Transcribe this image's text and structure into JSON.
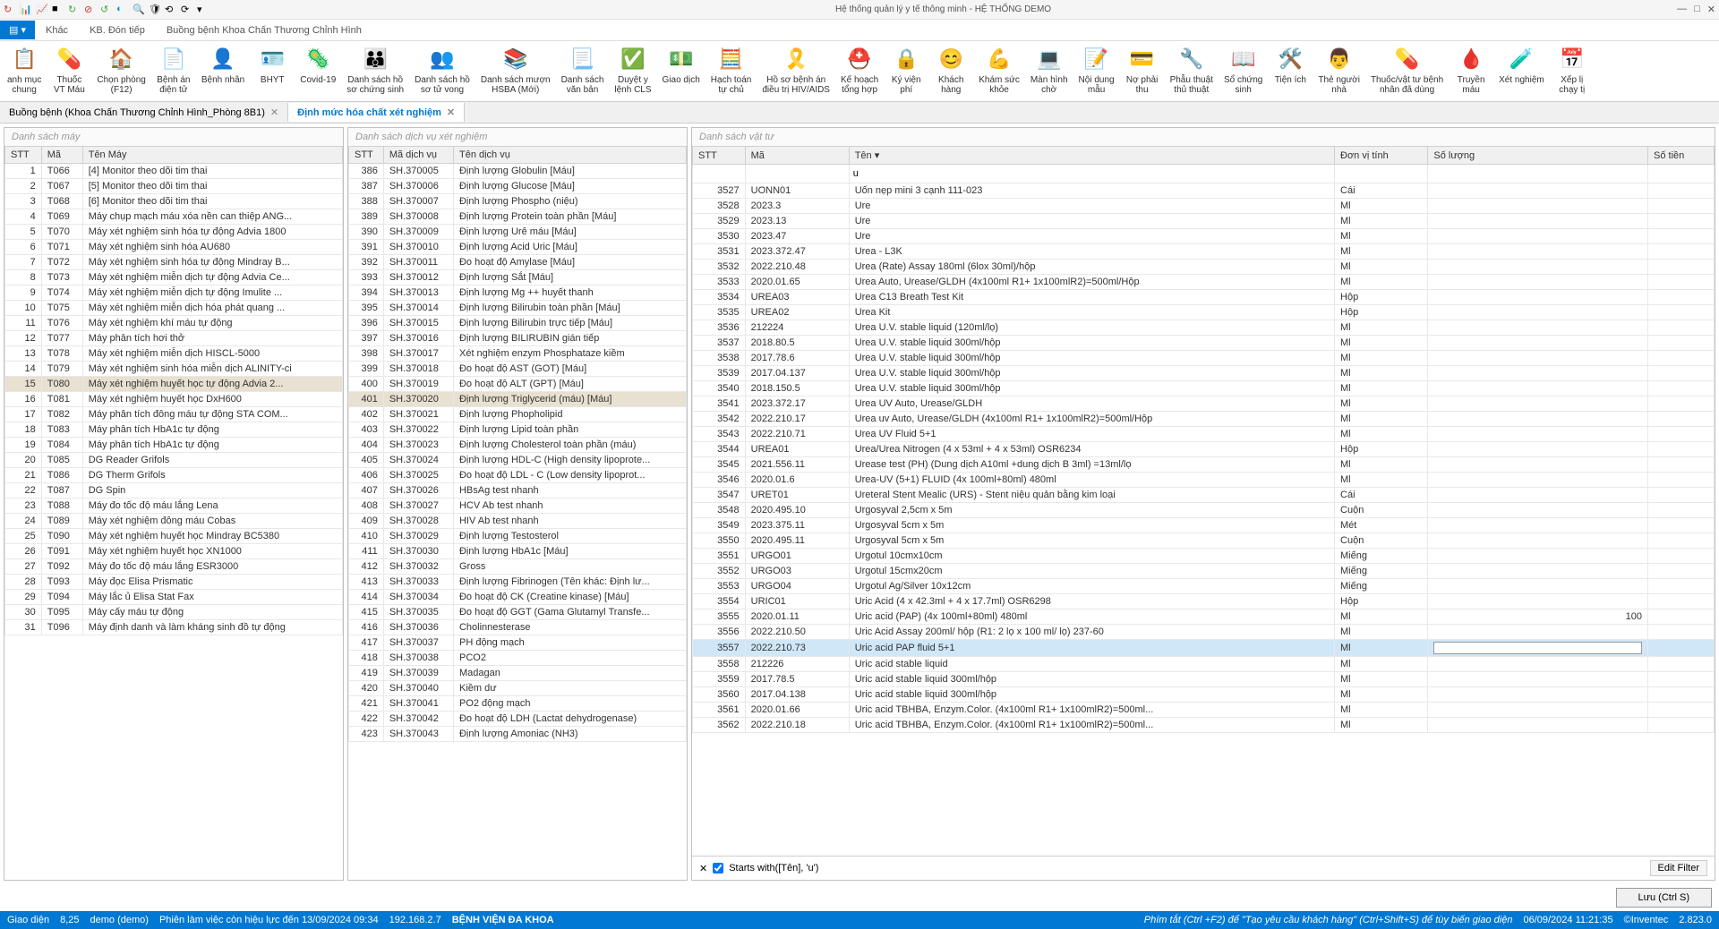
{
  "titlebar": {
    "title": "Hệ thống quản lý y tế thông minh - HỆ THỐNG DEMO"
  },
  "ribbonTabs": [
    {
      "label": "Khác",
      "active": false
    },
    {
      "label": "KB. Đón tiếp",
      "active": false
    },
    {
      "label": "Buồng bệnh Khoa Chấn Thương Chỉnh Hình",
      "active": false
    }
  ],
  "ribbon": [
    {
      "ic": "📋",
      "l": "anh mục\nchung",
      "c": "#d33"
    },
    {
      "ic": "💊",
      "l": "Thuốc\nVT Máu",
      "c": "#b44"
    },
    {
      "ic": "🏠",
      "l": "Chọn phòng\n(F12)",
      "c": "#d55"
    },
    {
      "ic": "📄",
      "l": "Bệnh án\nđiện tử",
      "c": "#4a4"
    },
    {
      "ic": "👤",
      "l": "Bệnh nhân",
      "c": "#888"
    },
    {
      "ic": "🪪",
      "l": "BHYT",
      "c": "#b95"
    },
    {
      "ic": "🦠",
      "l": "Covid-19",
      "c": "#d33"
    },
    {
      "ic": "👪",
      "l": "Danh sách hồ\nsơ chứng sinh",
      "c": "#666"
    },
    {
      "ic": "👥",
      "l": "Danh sách hồ\nsơ tử vong",
      "c": "#666"
    },
    {
      "ic": "📚",
      "l": "Danh sách mượn\nHSBA (Mới)",
      "c": "#888"
    },
    {
      "ic": "📃",
      "l": "Danh sách\nvăn bản",
      "c": "#888"
    },
    {
      "ic": "✅",
      "l": "Duyệt y\nlệnh CLS",
      "c": "#4a4"
    },
    {
      "ic": "💵",
      "l": "Giao dịch",
      "c": "#4a4"
    },
    {
      "ic": "🧮",
      "l": "Hạch toán\ntự chủ",
      "c": "#888"
    },
    {
      "ic": "🎗️",
      "l": "Hồ sơ bệnh án\nđiều trị HIV/AIDS",
      "c": "#d33"
    },
    {
      "ic": "⛑️",
      "l": "Kế hoạch\ntổng hợp",
      "c": "#d33"
    },
    {
      "ic": "🔒",
      "l": "Ký viện\nphí",
      "c": "#b95"
    },
    {
      "ic": "😊",
      "l": "Khách\nhàng",
      "c": "#888"
    },
    {
      "ic": "💪",
      "l": "Khám sức\nkhỏe",
      "c": "#888"
    },
    {
      "ic": "💻",
      "l": "Màn hình\nchờ",
      "c": "#888"
    },
    {
      "ic": "📝",
      "l": "Nội dung\nmẫu",
      "c": "#888"
    },
    {
      "ic": "💳",
      "l": "Nợ phải\nthu",
      "c": "#888"
    },
    {
      "ic": "🔧",
      "l": "Phẫu thuật\nthủ thuật",
      "c": "#888"
    },
    {
      "ic": "📖",
      "l": "Sổ chứng\nsinh",
      "c": "#888"
    },
    {
      "ic": "🛠️",
      "l": "Tiện ích",
      "c": "#888"
    },
    {
      "ic": "👨",
      "l": "Thẻ người\nnhà",
      "c": "#888"
    },
    {
      "ic": "💊",
      "l": "Thuốc/vật tư bệnh\nnhân đã dùng",
      "c": "#d33"
    },
    {
      "ic": "🩸",
      "l": "Truyền\nmáu",
      "c": "#d33"
    },
    {
      "ic": "🧪",
      "l": "Xét nghiệm",
      "c": "#55a"
    },
    {
      "ic": "📅",
      "l": "Xếp lị\nchạy tị",
      "c": "#888"
    }
  ],
  "doctabs": [
    {
      "label": "Buồng bệnh (Khoa Chấn Thương Chỉnh Hình_Phòng 8B1)",
      "active": false
    },
    {
      "label": "Định mức hóa chất xét nghiệm",
      "active": true
    }
  ],
  "panel1": {
    "title": "Danh sách máy",
    "cols": [
      "STT",
      "Mã",
      "Tên Máy"
    ],
    "rows": [
      [
        "1",
        "T066",
        "[4] Monitor theo dõi tim thai"
      ],
      [
        "2",
        "T067",
        "[5] Monitor theo dõi tim thai"
      ],
      [
        "3",
        "T068",
        "[6] Monitor theo dõi tim thai"
      ],
      [
        "4",
        "T069",
        "Máy chụp mạch máu xóa nền can thiệp ANG..."
      ],
      [
        "5",
        "T070",
        "Máy xét nghiệm sinh hóa tự động Advia 1800"
      ],
      [
        "6",
        "T071",
        "Máy xét nghiệm sinh hóa AU680"
      ],
      [
        "7",
        "T072",
        "Máy xét nghiệm sinh hóa tự động Mindray B..."
      ],
      [
        "8",
        "T073",
        "Máy xét nghiệm miễn dịch tự động Advia Ce..."
      ],
      [
        "9",
        "T074",
        "Máy xét nghiệm miễn dịch tự động Imulite ..."
      ],
      [
        "10",
        "T075",
        "Máy xét nghiệm miễn dịch hóa phát quang ..."
      ],
      [
        "11",
        "T076",
        "Máy xét nghiệm khí máu tự động"
      ],
      [
        "12",
        "T077",
        "Máy phân tích hơi thở"
      ],
      [
        "13",
        "T078",
        "Máy xét nghiệm miễn dịch HISCL-5000"
      ],
      [
        "14",
        "T079",
        "Máy xét nghiệm sinh hóa miễn dịch ALINITY-ci"
      ],
      [
        "15",
        "T080",
        "Máy xét nghiệm huyết học tự động Advia 2..."
      ],
      [
        "16",
        "T081",
        "Máy xét nghiệm huyết học DxH600"
      ],
      [
        "17",
        "T082",
        "Máy phân tích đông máu tự động STA COM..."
      ],
      [
        "18",
        "T083",
        "Máy phân tích HbA1c tự động"
      ],
      [
        "19",
        "T084",
        "Máy phân tích HbA1c tự động"
      ],
      [
        "20",
        "T085",
        "DG Reader Grifols"
      ],
      [
        "21",
        "T086",
        "DG Therm Grifols"
      ],
      [
        "22",
        "T087",
        "DG Spin"
      ],
      [
        "23",
        "T088",
        "Máy đo tốc độ máu lắng Lena"
      ],
      [
        "24",
        "T089",
        "Máy xét nghiệm đông máu Cobas"
      ],
      [
        "25",
        "T090",
        "Máy xét nghiệm huyết học Mindray BC5380"
      ],
      [
        "26",
        "T091",
        "Máy xét nghiệm huyết học XN1000"
      ],
      [
        "27",
        "T092",
        "Máy đo tốc độ máu lắng ESR3000"
      ],
      [
        "28",
        "T093",
        "Máy đọc Elisa Prismatic"
      ],
      [
        "29",
        "T094",
        "Máy lắc ủ Elisa Stat Fax"
      ],
      [
        "30",
        "T095",
        "Máy cấy máu tự động"
      ],
      [
        "31",
        "T096",
        "Máy định danh và làm kháng sinh đồ tự động"
      ]
    ],
    "selectedIdx": 14
  },
  "panel2": {
    "title": "Danh sách dịch vụ xét nghiệm",
    "cols": [
      "STT",
      "Mã dịch vụ",
      "Tên dịch vụ"
    ],
    "rows": [
      [
        "386",
        "SH.370005",
        "Định lượng Globulin [Máu]"
      ],
      [
        "387",
        "SH.370006",
        "Định lượng Glucose [Máu]"
      ],
      [
        "388",
        "SH.370007",
        "Định lượng Phospho (niệu)"
      ],
      [
        "389",
        "SH.370008",
        "Định lượng Protein toàn phần [Máu]"
      ],
      [
        "390",
        "SH.370009",
        "Định lượng Urê máu [Máu]"
      ],
      [
        "391",
        "SH.370010",
        "Định lượng Acid Uric [Máu]"
      ],
      [
        "392",
        "SH.370011",
        "Đo hoạt độ Amylase [Máu]"
      ],
      [
        "393",
        "SH.370012",
        "Định lượng Sắt [Máu]"
      ],
      [
        "394",
        "SH.370013",
        "Định lượng Mg ++ huyết thanh"
      ],
      [
        "395",
        "SH.370014",
        "Định lượng Bilirubin toàn phần [Máu]"
      ],
      [
        "396",
        "SH.370015",
        "Định lượng Bilirubin trực tiếp [Máu]"
      ],
      [
        "397",
        "SH.370016",
        "Định lượng BILIRUBIN gián tiếp"
      ],
      [
        "398",
        "SH.370017",
        "Xét nghiệm enzym Phosphataze kiềm"
      ],
      [
        "399",
        "SH.370018",
        "Đo hoạt độ AST (GOT) [Máu]"
      ],
      [
        "400",
        "SH.370019",
        "Đo hoạt độ ALT (GPT) [Máu]"
      ],
      [
        "401",
        "SH.370020",
        "Định lượng Triglycerid (máu) [Máu]"
      ],
      [
        "402",
        "SH.370021",
        "Định lượng Phopholipid"
      ],
      [
        "403",
        "SH.370022",
        "Định lượng Lipid toàn phần"
      ],
      [
        "404",
        "SH.370023",
        "Định lượng Cholesterol toàn phần (máu)"
      ],
      [
        "405",
        "SH.370024",
        "Định lượng HDL-C (High density lipoprote..."
      ],
      [
        "406",
        "SH.370025",
        "Đo hoạt độ LDL - C (Low density lipoprot..."
      ],
      [
        "407",
        "SH.370026",
        "HBsAg test nhanh"
      ],
      [
        "408",
        "SH.370027",
        "HCV Ab test nhanh"
      ],
      [
        "409",
        "SH.370028",
        "HIV Ab test nhanh"
      ],
      [
        "410",
        "SH.370029",
        "Định lượng Testosterol"
      ],
      [
        "411",
        "SH.370030",
        "Định lượng HbA1c [Máu]"
      ],
      [
        "412",
        "SH.370032",
        "Gross"
      ],
      [
        "413",
        "SH.370033",
        "Định lượng Fibrinogen (Tên khác: Định lư..."
      ],
      [
        "414",
        "SH.370034",
        "Đo hoạt độ CK (Creatine kinase) [Máu]"
      ],
      [
        "415",
        "SH.370035",
        "Đo hoạt độ GGT (Gama Glutamyl Transfe..."
      ],
      [
        "416",
        "SH.370036",
        "Cholinnesterase"
      ],
      [
        "417",
        "SH.370037",
        "PH động mạch"
      ],
      [
        "418",
        "SH.370038",
        "PCO2"
      ],
      [
        "419",
        "SH.370039",
        "Madagan"
      ],
      [
        "420",
        "SH.370040",
        "Kiềm dư"
      ],
      [
        "421",
        "SH.370041",
        "PO2 động mạch"
      ],
      [
        "422",
        "SH.370042",
        "Đo hoạt độ LDH (Lactat dehydrogenase)"
      ],
      [
        "423",
        "SH.370043",
        "Định lượng Amoniac (NH3)"
      ]
    ],
    "selectedIdx": 15
  },
  "panel3": {
    "title": "Danh sách vật tư",
    "cols": [
      "STT",
      "Mã",
      "Tên",
      "Đơn vị tính",
      "Số lượng",
      "Số tiền"
    ],
    "filterText": "u",
    "rows": [
      [
        "3527",
        "UONN01",
        "Uốn nẹp mini 3 cạnh 111-023",
        "Cái",
        "",
        ""
      ],
      [
        "3528",
        "2023.3",
        "Ure",
        "Ml",
        "",
        ""
      ],
      [
        "3529",
        "2023.13",
        "Ure",
        "Ml",
        "",
        ""
      ],
      [
        "3530",
        "2023.47",
        "Ure",
        "Ml",
        "",
        ""
      ],
      [
        "3531",
        "2023.372.47",
        "Urea - L3K",
        "Ml",
        "",
        ""
      ],
      [
        "3532",
        "2022.210.48",
        "Urea (Rate) Assay 180ml (6lox 30ml)/hộp",
        "Ml",
        "",
        ""
      ],
      [
        "3533",
        "2020.01.65",
        "Urea Auto, Urease/GLDH (4x100ml R1+ 1x100mlR2)=500ml/Hộp",
        "Ml",
        "",
        ""
      ],
      [
        "3534",
        "UREA03",
        "Urea C13 Breath Test Kit",
        "Hộp",
        "",
        ""
      ],
      [
        "3535",
        "UREA02",
        "Urea Kit",
        "Hộp",
        "",
        ""
      ],
      [
        "3536",
        "212224",
        "Urea U.V. stable liquid (120ml/lọ)",
        "Ml",
        "",
        ""
      ],
      [
        "3537",
        "2018.80.5",
        "Urea U.V. stable liquid 300ml/hộp",
        "Ml",
        "",
        ""
      ],
      [
        "3538",
        "2017.78.6",
        "Urea U.V. stable liquid 300ml/hộp",
        "Ml",
        "",
        ""
      ],
      [
        "3539",
        "2017.04.137",
        "Urea U.V. stable liquid 300ml/hộp",
        "Ml",
        "",
        ""
      ],
      [
        "3540",
        "2018.150.5",
        "Urea U.V. stable liquid 300ml/hộp",
        "Ml",
        "",
        ""
      ],
      [
        "3541",
        "2023.372.17",
        "Urea UV Auto, Urease/GLDH",
        "Ml",
        "",
        ""
      ],
      [
        "3542",
        "2022.210.17",
        "Urea uv Auto, Urease/GLDH (4x100ml R1+ 1x100mlR2)=500ml/Hộp",
        "Ml",
        "",
        ""
      ],
      [
        "3543",
        "2022.210.71",
        "Urea UV Fluid 5+1",
        "Ml",
        "",
        ""
      ],
      [
        "3544",
        "UREA01",
        "Urea/Urea Nitrogen (4 x 53ml + 4 x 53ml) OSR6234",
        "Hộp",
        "",
        ""
      ],
      [
        "3545",
        "2021.556.11",
        "Urease test (PH) (Dung dịch A10ml +dung dịch B 3ml) =13ml/lọ",
        "Ml",
        "",
        ""
      ],
      [
        "3546",
        "2020.01.6",
        "Urea-UV (5+1) FLUID (4x 100ml+80ml) 480ml",
        "Ml",
        "",
        ""
      ],
      [
        "3547",
        "URET01",
        "Ureteral Stent Mealic (URS) - Stent niệu quản bằng kim loại",
        "Cái",
        "",
        ""
      ],
      [
        "3548",
        "2020.495.10",
        "Urgosyval 2,5cm x 5m",
        "Cuộn",
        "",
        ""
      ],
      [
        "3549",
        "2023.375.11",
        "Urgosyval 5cm x 5m",
        "Mét",
        "",
        ""
      ],
      [
        "3550",
        "2020.495.11",
        "Urgosyval 5cm x 5m",
        "Cuộn",
        "",
        ""
      ],
      [
        "3551",
        "URGO01",
        "Urgotul 10cmx10cm",
        "Miếng",
        "",
        ""
      ],
      [
        "3552",
        "URGO03",
        "Urgotul 15cmx20cm",
        "Miếng",
        "",
        ""
      ],
      [
        "3553",
        "URGO04",
        "Urgotul Ag/Silver 10x12cm",
        "Miếng",
        "",
        ""
      ],
      [
        "3554",
        "URIC01",
        "Uric Acid (4 x 42.3ml + 4 x 17.7ml) OSR6298",
        "Hộp",
        "",
        ""
      ],
      [
        "3555",
        "2020.01.11",
        "Uric acid (PAP) (4x 100ml+80ml) 480ml",
        "Ml",
        "100",
        ""
      ],
      [
        "3556",
        "2022.210.50",
        "Uric Acid Assay 200ml/ hộp (R1: 2 lọ x 100 ml/ lọ) 237-60",
        "Ml",
        "",
        ""
      ],
      [
        "3557",
        "2022.210.73",
        "Uric acid PAP fluid 5+1",
        "Ml",
        "",
        ""
      ],
      [
        "3558",
        "212226",
        "Uric acid stable liquid",
        "Ml",
        "",
        ""
      ],
      [
        "3559",
        "2017.78.5",
        "Uric acid stable liquid 300ml/hộp",
        "Ml",
        "",
        ""
      ],
      [
        "3560",
        "2017.04.138",
        "Uric acid stable liquid 300ml/hộp",
        "Ml",
        "",
        ""
      ],
      [
        "3561",
        "2020.01.66",
        "Uric acid TBHBA, Enzym.Color. (4x100ml R1+ 1x100mlR2)=500ml...",
        "Ml",
        "",
        ""
      ],
      [
        "3562",
        "2022.210.18",
        "Uric acid TBHBA, Enzym.Color. (4x100ml R1+ 1x100mlR2)=500ml...",
        "Ml",
        "",
        ""
      ]
    ],
    "selectedIdx": 30,
    "filterSummary": "Starts with([Tên], 'u')",
    "editFilter": "Edit Filter"
  },
  "saveLabel": "Lưu (Ctrl S)",
  "status": {
    "giaodien": "Giao diện",
    "zoom": "8,25",
    "user": "demo (demo)",
    "session": "Phiên làm việc còn hiệu lực đến 13/09/2024 09:34",
    "ip": "192.168.2.7",
    "hosp": "BỆNH VIỆN ĐA KHOA",
    "hint": "Phím tắt (Ctrl +F2) để \"Tạo yêu cầu khách hàng\" (Ctrl+Shift+S) để tùy biến giao diện",
    "date": "06/09/2024 11:21:35",
    "vendor": "©Inventec",
    "ver": "2.823.0"
  }
}
